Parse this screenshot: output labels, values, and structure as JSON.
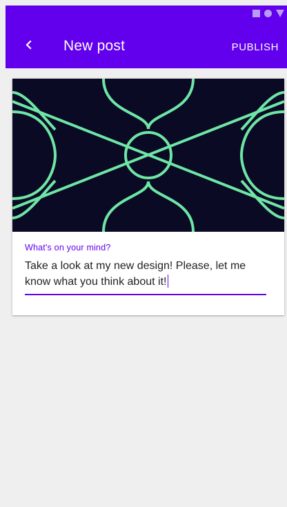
{
  "status_bar": {
    "icons": [
      "square-icon",
      "circle-icon",
      "triangle-icon"
    ]
  },
  "app_bar": {
    "title": "New post",
    "action_label": "PUBLISH",
    "back_icon": "chevron-left-icon",
    "color": "#6200ee"
  },
  "post": {
    "image_colors": {
      "background": "#0b0a24",
      "lines": "#6ee6a6"
    },
    "field_label": "What's on your mind?",
    "field_value": "Take a look at my new design! Please, let me know what you think about it!",
    "accent": "#6200ee"
  }
}
